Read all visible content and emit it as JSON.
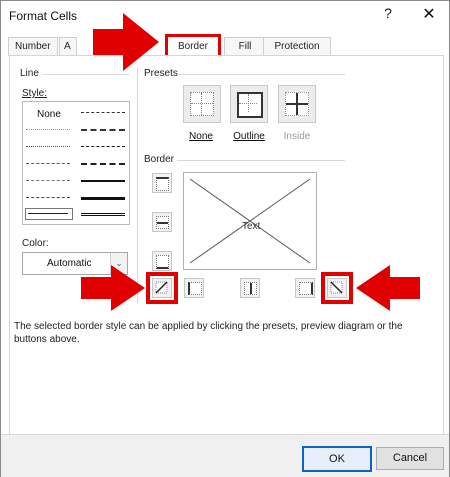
{
  "dialog": {
    "title": "Format Cells",
    "help_symbol": "?",
    "close_symbol": "✕"
  },
  "tabs": [
    {
      "label": "Number"
    },
    {
      "label": "A"
    },
    {
      "label": "Border"
    },
    {
      "label": "Fill"
    },
    {
      "label": "Protection"
    }
  ],
  "line": {
    "group_label": "Line",
    "style_label": "Style:",
    "style_none": "None",
    "color_label": "Color:",
    "color_value": "Automatic",
    "dropdown_symbol": "⌄"
  },
  "presets": {
    "group_label": "Presets",
    "none": "None",
    "outline": "Outline",
    "inside": "Inside"
  },
  "border": {
    "group_label": "Border",
    "preview_text": "Text"
  },
  "description": "The selected border style can be applied by clicking the presets, preview diagram or the buttons above.",
  "buttons": {
    "ok": "OK",
    "cancel": "Cancel"
  },
  "colors": {
    "highlight": "#e00000",
    "ok_border": "#0a64c8"
  }
}
